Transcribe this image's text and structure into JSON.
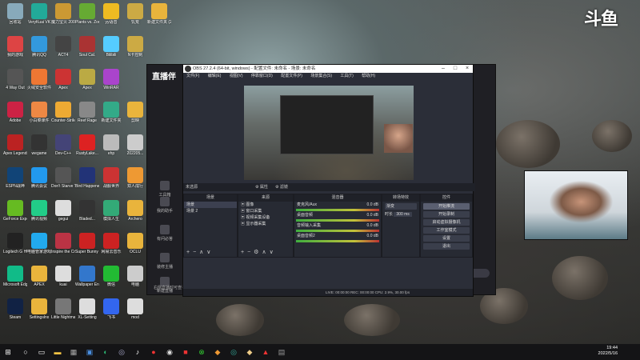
{
  "desktop_icons": [
    {
      "label": "回收站",
      "color": "#8ab",
      "col": 0,
      "row": 0
    },
    {
      "label": "VeryKuai VK",
      "color": "#2a9",
      "col": 1,
      "row": 0
    },
    {
      "label": "魔力宝贝 2003",
      "color": "#c93",
      "col": 2,
      "row": 0
    },
    {
      "label": "Plants vs. Zombies G...",
      "color": "#6a3",
      "col": 3,
      "row": 0
    },
    {
      "label": "yy语音",
      "color": "#eb2",
      "col": 4,
      "row": 0
    },
    {
      "label": "饥荒",
      "color": "#ca4",
      "col": 5,
      "row": 0
    },
    {
      "label": "新建文件夹 (2)",
      "color": "#e9b43c",
      "col": 6,
      "row": 0
    },
    {
      "label": "我的游戏",
      "color": "#d44",
      "col": 0,
      "row": 1
    },
    {
      "label": "腾讯QQ",
      "color": "#39d",
      "col": 1,
      "row": 1
    },
    {
      "label": "ACT4",
      "color": "#444",
      "col": 2,
      "row": 1
    },
    {
      "label": "Soul Cal.",
      "color": "#a33",
      "col": 3,
      "row": 1
    },
    {
      "label": "Bilibili",
      "color": "#5cf",
      "col": 4,
      "row": 1
    },
    {
      "label": "N卡控制",
      "color": "#ca4",
      "col": 5,
      "row": 1
    },
    {
      "label": "4 Way Out",
      "color": "#555",
      "col": 0,
      "row": 2
    },
    {
      "label": "火绒安全软件",
      "color": "#e73",
      "col": 1,
      "row": 2
    },
    {
      "label": "Apex",
      "color": "#c33",
      "col": 2,
      "row": 2
    },
    {
      "label": "Apex",
      "color": "#ba4",
      "col": 3,
      "row": 2
    },
    {
      "label": "WinRAR",
      "color": "#a4c",
      "col": 4,
      "row": 2
    },
    {
      "label": "Adobe",
      "color": "#c24",
      "col": 0,
      "row": 3
    },
    {
      "label": "小白菜课件",
      "color": "#e84",
      "col": 1,
      "row": 3
    },
    {
      "label": "Counter-Strike Global Off...",
      "color": "#ea3",
      "col": 2,
      "row": 3
    },
    {
      "label": "Reef Rage",
      "color": "#888",
      "col": 3,
      "row": 3
    },
    {
      "label": "新建文件夹",
      "color": "#3a8",
      "col": 4,
      "row": 3
    },
    {
      "label": "剪映",
      "color": "#e9b43c",
      "col": 5,
      "row": 3
    },
    {
      "label": "Apex Legends",
      "color": "#b22",
      "col": 0,
      "row": 4
    },
    {
      "label": "wegame",
      "color": "#333",
      "col": 1,
      "row": 4
    },
    {
      "label": "Dev-C++",
      "color": "#447",
      "col": 2,
      "row": 4
    },
    {
      "label": "RustyLake...",
      "color": "#d22",
      "col": 3,
      "row": 4
    },
    {
      "label": "ehp",
      "color": "#bbb",
      "col": 4,
      "row": 4
    },
    {
      "label": "202205...",
      "color": "#ccc",
      "col": 5,
      "row": 4
    },
    {
      "label": "ESPN战神",
      "color": "#147",
      "col": 0,
      "row": 5
    },
    {
      "label": "腾讯会议",
      "color": "#29e",
      "col": 1,
      "row": 5
    },
    {
      "label": "Don't Starve Together",
      "color": "#555",
      "col": 2,
      "row": 5
    },
    {
      "label": "Bird Happened",
      "color": "#237",
      "col": 3,
      "row": 5
    },
    {
      "label": "战舰世界",
      "color": "#c33",
      "col": 4,
      "row": 5
    },
    {
      "label": "双人成行",
      "color": "#e93",
      "col": 5,
      "row": 5
    },
    {
      "label": "GeForce Experience",
      "color": "#6b2",
      "col": 0,
      "row": 6
    },
    {
      "label": "腾讯视频",
      "color": "#2c8",
      "col": 1,
      "row": 6
    },
    {
      "label": "gegui",
      "color": "#ddd",
      "col": 2,
      "row": 6
    },
    {
      "label": "Bladed...",
      "color": "#333",
      "col": 3,
      "row": 6
    },
    {
      "label": "模拟人生",
      "color": "#3a7",
      "col": 4,
      "row": 6
    },
    {
      "label": "Archero",
      "color": "#e9b43c",
      "col": 5,
      "row": 6
    },
    {
      "label": "Logitech G HUB",
      "color": "#222",
      "col": 0,
      "row": 7
    },
    {
      "label": "电脑管家游戏加速",
      "color": "#2ae",
      "col": 1,
      "row": 7
    },
    {
      "label": "Inspire the Creator",
      "color": "#b34",
      "col": 2,
      "row": 7
    },
    {
      "label": "Super Bunny Man",
      "color": "#c22",
      "col": 3,
      "row": 7
    },
    {
      "label": "网易云音乐",
      "color": "#c22",
      "col": 4,
      "row": 7
    },
    {
      "label": "OCLU",
      "color": "#e9b43c",
      "col": 5,
      "row": 7
    },
    {
      "label": "Microsoft Edge",
      "color": "#1b8",
      "col": 0,
      "row": 8
    },
    {
      "label": "APEX",
      "color": "#e9b43c",
      "col": 1,
      "row": 8
    },
    {
      "label": "kuai",
      "color": "#ddd",
      "col": 2,
      "row": 8
    },
    {
      "label": "Wallpaper Engine",
      "color": "#37c",
      "col": 3,
      "row": 8
    },
    {
      "label": "微信",
      "color": "#2b3",
      "col": 4,
      "row": 8
    },
    {
      "label": "电脑",
      "color": "#ccc",
      "col": 5,
      "row": 8
    },
    {
      "label": "Steam",
      "color": "#124",
      "col": 0,
      "row": 9
    },
    {
      "label": "Settingslnx",
      "color": "#e9b43c",
      "col": 1,
      "row": 9
    },
    {
      "label": "Little Nightmares",
      "color": "#777",
      "col": 2,
      "row": 9
    },
    {
      "label": "XL-Setting",
      "color": "#ddd",
      "col": 3,
      "row": 9
    },
    {
      "label": "飞书",
      "color": "#36e",
      "col": 4,
      "row": 9
    },
    {
      "label": "mod",
      "color": "#ddd",
      "col": 5,
      "row": 9
    }
  ],
  "douyu_logo": "斗鱼",
  "live_app": {
    "brand": "直播伴",
    "side_items": [
      "工具箱",
      "我的助手",
      "有问必答",
      "装修主播",
      "新建直播"
    ],
    "bottom_items": [
      "直播间设置",
      "弹幕",
      "开播成就",
      "播后数据",
      "礼物设置"
    ],
    "notice": "右侧直播时可查看数据"
  },
  "obs": {
    "title": "OBS 27.2.4 (64-bit, windows) - 配置文件: 未命名 - 场景: 未命名",
    "menu": [
      "文件(F)",
      "编辑(E)",
      "视图(V)",
      "停靠窗口(D)",
      "配置文件(P)",
      "场景集合(S)",
      "工具(T)",
      "帮助(H)"
    ],
    "scene_bar": "未选源",
    "scene_bar_btns": [
      "属性",
      "滤镜"
    ],
    "docks": {
      "scenes": {
        "header": "场景",
        "items": [
          "场景",
          "场景 2"
        ]
      },
      "sources": {
        "header": "来源",
        "items": [
          "图像",
          "窗口采集",
          "视频采集设备",
          "显示器采集"
        ]
      },
      "mixer": {
        "header": "混音器",
        "items": [
          "麦克风/Aux",
          "桌面音频",
          "音频输入采集",
          "桌面音频2"
        ],
        "levels": [
          "0.0 dB",
          "0.0 dB",
          "0.0 dB",
          "0.0 dB"
        ]
      },
      "transitions": {
        "header": "转场特效",
        "type": "渐变",
        "duration_label": "时长",
        "duration": "300 ms"
      },
      "controls": {
        "header": "控件",
        "buttons": [
          "开始推流",
          "开始录制",
          "启动虚拟摄像机",
          "工作室模式",
          "设置",
          "退出"
        ]
      }
    },
    "status": "LIVE: 00:00:00   REC: 00:00:00   CPU: 2.9%, 30.00 fps"
  },
  "taskbar": {
    "time": "19:44",
    "date": "2022/5/16",
    "icons": [
      "start",
      "search",
      "task-view",
      "file-explorer",
      "store",
      "edge",
      "steam",
      "tiktok",
      "netease-music",
      "obs",
      "wechat",
      "qq",
      "xbox",
      "game",
      "douyu-live",
      "explorer"
    ]
  }
}
